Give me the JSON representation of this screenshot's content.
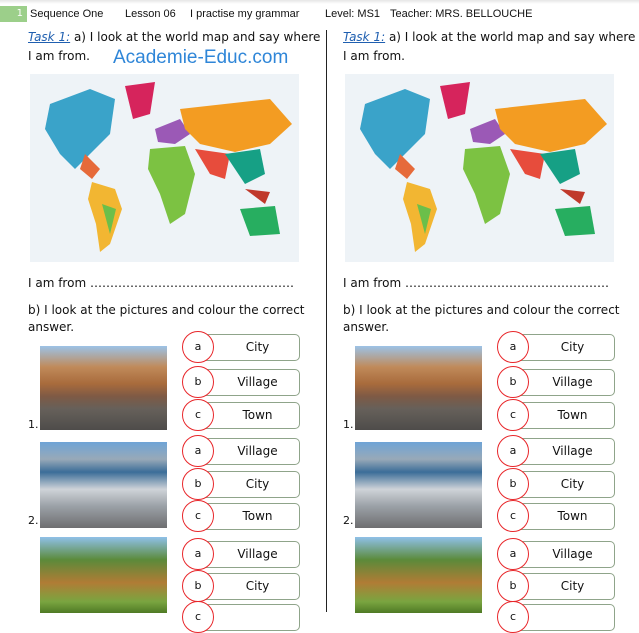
{
  "header": {
    "page_number": "1",
    "sequence": "Sequence One",
    "lesson": "Lesson 06",
    "topic": "I practise my grammar",
    "level": "Level: MS1",
    "teacher": "Teacher: MRS. BELLOUCHE"
  },
  "watermark": "Academie-Educ.com",
  "worksheet": {
    "task_label": "Task 1:",
    "task_a_line1": " a) I look at the world map and say where",
    "task_a_line2": "I am from.",
    "iam_from": "I am from ……………………………………………",
    "task_b_line1": "b) I look at the pictures and colour the correct",
    "task_b_line2": "answer.",
    "questions": [
      {
        "number": "1.",
        "picture": "town-street",
        "options": [
          {
            "letter": "a",
            "text": "City"
          },
          {
            "letter": "b",
            "text": "Village"
          },
          {
            "letter": "c",
            "text": "Town"
          }
        ]
      },
      {
        "number": "2.",
        "picture": "coastal-city",
        "options": [
          {
            "letter": "a",
            "text": "Village"
          },
          {
            "letter": "b",
            "text": "City"
          },
          {
            "letter": "c",
            "text": "Town"
          }
        ]
      },
      {
        "number": "",
        "picture": "countryside-village",
        "options": [
          {
            "letter": "a",
            "text": "Village"
          },
          {
            "letter": "b",
            "text": "City"
          },
          {
            "letter": "c",
            "text": ""
          }
        ]
      }
    ]
  },
  "colors": {
    "circle": "#e8262a",
    "box_border": "#8fa48a",
    "task_link": "#1f5fb0",
    "page_badge": "#9ccf8a"
  }
}
